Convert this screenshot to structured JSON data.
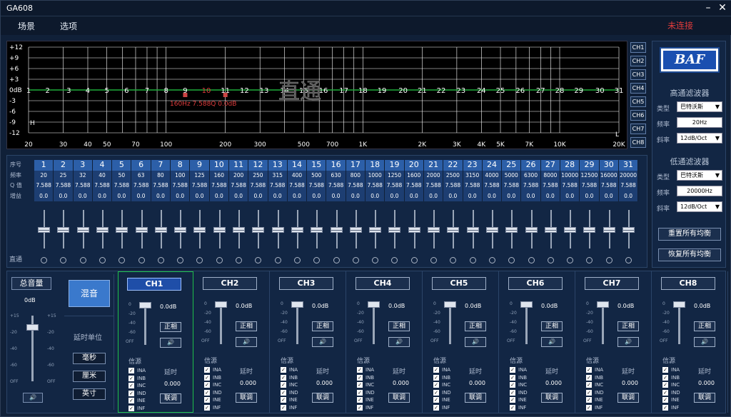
{
  "window": {
    "title": "GA608",
    "minimize": "–",
    "close": "✕"
  },
  "menu": {
    "scene": "场景",
    "options": "选项",
    "status": "未连接"
  },
  "graph": {
    "ylabels": [
      "+12",
      "+9",
      "+6",
      "+3",
      "0dB",
      "-3",
      "-6",
      "-9",
      "-12"
    ],
    "xlabels": [
      "20",
      "30",
      "40",
      "50",
      "70",
      "100",
      "200",
      "300",
      "500",
      "700",
      "1K",
      "2K",
      "3K",
      "4K",
      "5K",
      "7K",
      "10K",
      "20K"
    ],
    "band_labels": [
      "1",
      "2",
      "3",
      "4",
      "5",
      "6",
      "7",
      "8",
      "9",
      "10",
      "11",
      "12",
      "13",
      "14",
      "15",
      "16",
      "17",
      "18",
      "19",
      "20",
      "21",
      "22",
      "23",
      "24",
      "25",
      "26",
      "27",
      "28",
      "29",
      "30",
      "31"
    ],
    "selected_band": "10",
    "readout": "160Hz 7.588Q 0.0dB",
    "mode_text": "直通",
    "h_marker": "H",
    "l_marker": "L"
  },
  "channels_buttons": [
    "CH1",
    "CH2",
    "CH3",
    "CH4",
    "CH5",
    "CH6",
    "CH7",
    "CH8"
  ],
  "right_panel": {
    "logo": "BAF",
    "hp_title": "高通滤波器",
    "type_label": "类型",
    "hp_type": "巴特沃斯",
    "freq_label": "频率",
    "hp_freq": "20Hz",
    "slope_label": "斜率",
    "hp_slope": "12dB/Oct",
    "lp_title": "低通滤波器",
    "lp_type": "巴特沃斯",
    "lp_freq": "20000Hz",
    "lp_slope": "12dB/Oct",
    "reset_eq": "重置所有均衡",
    "restore_eq": "恢复所有均衡"
  },
  "eq": {
    "row_labels": [
      "序号",
      "频率",
      "Q 值",
      "增益"
    ],
    "bands": [
      "1",
      "2",
      "3",
      "4",
      "5",
      "6",
      "7",
      "8",
      "9",
      "10",
      "11",
      "12",
      "13",
      "14",
      "15",
      "16",
      "17",
      "18",
      "19",
      "20",
      "21",
      "22",
      "23",
      "24",
      "25",
      "26",
      "27",
      "28",
      "29",
      "30",
      "31"
    ],
    "freqs": [
      "20",
      "25",
      "32",
      "40",
      "50",
      "63",
      "80",
      "100",
      "125",
      "160",
      "200",
      "250",
      "315",
      "400",
      "500",
      "630",
      "800",
      "1000",
      "1250",
      "1600",
      "2000",
      "2500",
      "3150",
      "4000",
      "5000",
      "6300",
      "8000",
      "10000",
      "12500",
      "16000",
      "20000"
    ],
    "q": "7.588",
    "gain": "0.0",
    "bypass_label": "直通"
  },
  "master": {
    "title": "总音量",
    "value": "0dB",
    "ticks": [
      "+15",
      "-20",
      "-40",
      "-60",
      "OFF"
    ],
    "ticks_right": [
      "+15",
      "-20",
      "-40",
      "-60",
      "OFF"
    ],
    "speaker": "🔊"
  },
  "mix": {
    "mix_label": "混音",
    "delay_unit": "延时单位",
    "ms": "毫秒",
    "cm": "厘米",
    "inch": "英寸"
  },
  "ch_strip": {
    "names": [
      "CH1",
      "CH2",
      "CH3",
      "CH4",
      "CH5",
      "CH6",
      "CH7",
      "CH8"
    ],
    "db": "0.0dB",
    "phase": "正相",
    "speaker": "🔊",
    "source_label": "信源",
    "delay_label": "延时",
    "delay_value": "0.000",
    "link": "联调",
    "inputs": [
      "INA",
      "INB",
      "INC",
      "IND",
      "INE",
      "INF"
    ],
    "ticks": [
      "0",
      "-20",
      "-40",
      "-60",
      "OFF"
    ],
    "check": "✓"
  }
}
